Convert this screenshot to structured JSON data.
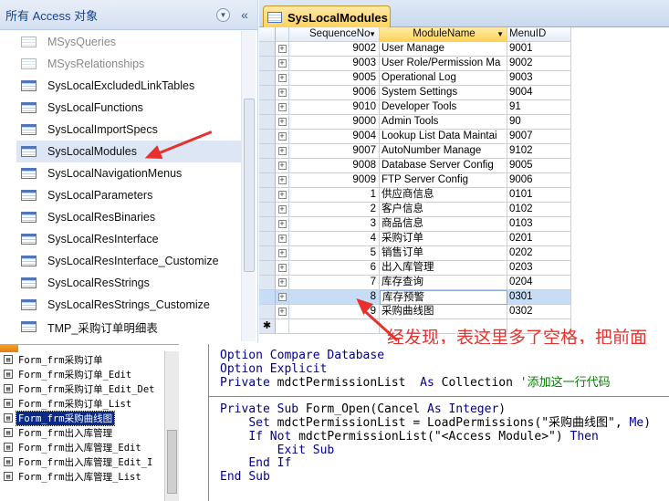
{
  "nav": {
    "title": "所有 Access 对象",
    "items": [
      {
        "label": "MSysQueries",
        "dim": true
      },
      {
        "label": "MSysRelationships",
        "dim": true
      },
      {
        "label": "SysLocalExcludedLinkTables"
      },
      {
        "label": "SysLocalFunctions"
      },
      {
        "label": "SysLocalImportSpecs"
      },
      {
        "label": "SysLocalModules",
        "selected": true
      },
      {
        "label": "SysLocalNavigationMenus"
      },
      {
        "label": "SysLocalParameters"
      },
      {
        "label": "SysLocalResBinaries"
      },
      {
        "label": "SysLocalResInterface"
      },
      {
        "label": "SysLocalResInterface_Customize"
      },
      {
        "label": "SysLocalResStrings"
      },
      {
        "label": "SysLocalResStrings_Customize"
      },
      {
        "label": "TMP_采购订单明细表"
      }
    ]
  },
  "table": {
    "tab_label": "SysLocalModules",
    "columns": [
      "SequenceNo",
      "ModuleName",
      "MenuID"
    ],
    "rows": [
      {
        "seq": "9002",
        "name": "User Manage",
        "menu": "9001"
      },
      {
        "seq": "9003",
        "name": "User Role/Permission Ma",
        "menu": "9002"
      },
      {
        "seq": "9005",
        "name": "Operational Log",
        "menu": "9003"
      },
      {
        "seq": "9006",
        "name": "System Settings",
        "menu": "9004"
      },
      {
        "seq": "9010",
        "name": "Developer Tools",
        "menu": "91"
      },
      {
        "seq": "9000",
        "name": "Admin Tools",
        "menu": "90"
      },
      {
        "seq": "9004",
        "name": "Lookup List Data Maintai",
        "menu": "9007"
      },
      {
        "seq": "9007",
        "name": "AutoNumber Manage",
        "menu": "9102"
      },
      {
        "seq": "9008",
        "name": "Database Server Config",
        "menu": "9005"
      },
      {
        "seq": "9009",
        "name": "FTP Server Config",
        "menu": "9006"
      },
      {
        "seq": "1",
        "name": "供应商信息",
        "menu": "0101"
      },
      {
        "seq": "2",
        "name": "客户信息",
        "menu": "0102"
      },
      {
        "seq": "3",
        "name": "商品信息",
        "menu": "0103"
      },
      {
        "seq": "4",
        "name": "采购订单",
        "menu": "0201"
      },
      {
        "seq": "5",
        "name": "销售订单",
        "menu": "0202"
      },
      {
        "seq": "6",
        "name": "出入库管理",
        "menu": "0203"
      },
      {
        "seq": "7",
        "name": "库存查询",
        "menu": "0204"
      },
      {
        "seq": "8",
        "name": "库存预警",
        "menu": "0301",
        "current": true
      },
      {
        "seq": "9",
        "name": " 采购曲线图",
        "menu": "0302"
      }
    ],
    "new_row_marker": "✱"
  },
  "annotation": "经发现，表这里多了空格，把前面空格去掉就好了",
  "project": {
    "items": [
      {
        "label": "Form_frm采购订单"
      },
      {
        "label": "Form_frm采购订单_Edit"
      },
      {
        "label": "Form_frm采购订单_Edit_Det"
      },
      {
        "label": "Form_frm采购订单_List"
      },
      {
        "label": "Form_frm采购曲线图",
        "selected": true
      },
      {
        "label": "Form_frm出入库管理"
      },
      {
        "label": "Form_frm出入库管理_Edit"
      },
      {
        "label": "Form_frm出入库管理_Edit_I"
      },
      {
        "label": "Form_frm出入库管理_List"
      }
    ]
  },
  "code": {
    "lines": [
      "Option Compare Database",
      "Option Explicit",
      "Private mdctPermissionList  As Collection '添加这一行代码",
      "",
      "Private Sub Form_Open(Cancel As Integer)",
      "    Set mdctPermissionList = LoadPermissions(\"采购曲线图\", Me)",
      "    If Not mdctPermissionList(\"<Access Module>\") Then",
      "        Exit Sub",
      "    End If",
      "End Sub"
    ]
  }
}
